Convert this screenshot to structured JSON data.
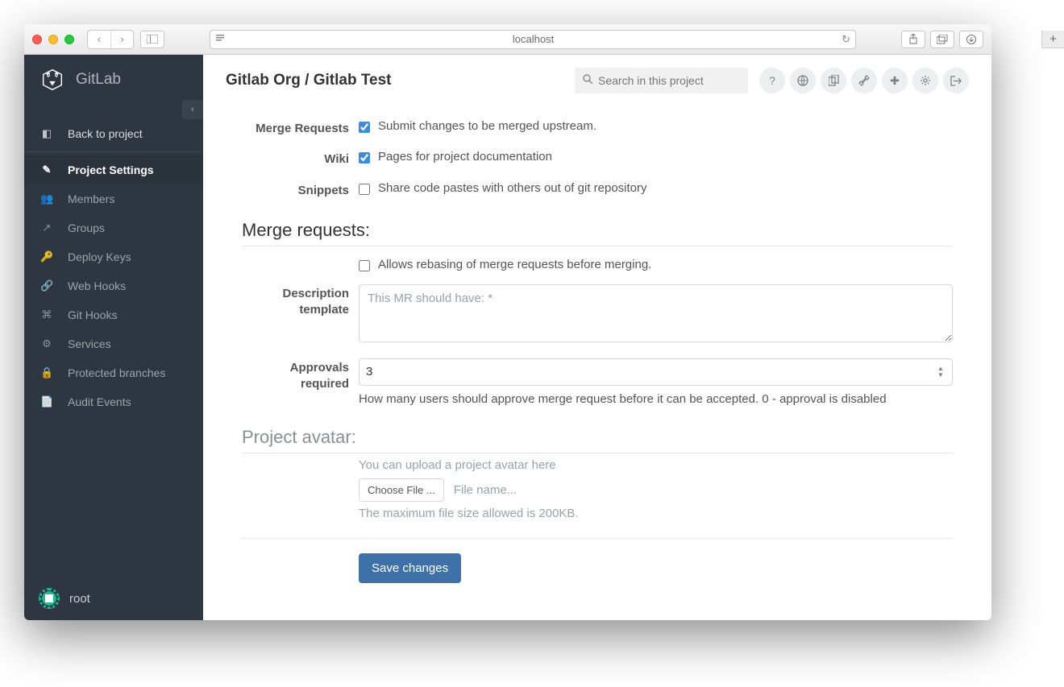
{
  "chrome": {
    "url": "localhost"
  },
  "brand": "GitLab",
  "sidebar": {
    "back": "Back to project",
    "items": [
      {
        "label": "Project Settings",
        "icon": "✎",
        "active": true
      },
      {
        "label": "Members",
        "icon": "👥"
      },
      {
        "label": "Groups",
        "icon": "↗"
      },
      {
        "label": "Deploy Keys",
        "icon": "🔑"
      },
      {
        "label": "Web Hooks",
        "icon": "🔗"
      },
      {
        "label": "Git Hooks",
        "icon": "⌘"
      },
      {
        "label": "Services",
        "icon": "⚙"
      },
      {
        "label": "Protected branches",
        "icon": "🔒"
      },
      {
        "label": "Audit Events",
        "icon": "📄"
      }
    ],
    "user": "root"
  },
  "breadcrumb": "Gitlab Org / Gitlab Test",
  "search": {
    "placeholder": "Search in this project"
  },
  "features": {
    "merge_requests": {
      "label": "Merge Requests",
      "desc": "Submit changes to be merged upstream.",
      "checked": true
    },
    "wiki": {
      "label": "Wiki",
      "desc": "Pages for project documentation",
      "checked": true
    },
    "snippets": {
      "label": "Snippets",
      "desc": "Share code pastes with others out of git repository",
      "checked": false
    }
  },
  "sections": {
    "merge_requests_title": "Merge requests:",
    "avatar_title": "Project avatar:"
  },
  "mr": {
    "rebase": {
      "desc": "Allows rebasing of merge requests before merging.",
      "checked": false
    },
    "template": {
      "label": "Description template",
      "placeholder": "This MR should have: *"
    },
    "approvals": {
      "label": "Approvals required",
      "value": "3",
      "help": "How many users should approve merge request before it can be accepted. 0 - approval is disabled"
    }
  },
  "avatar": {
    "hint": "You can upload a project avatar here",
    "choose": "Choose File ...",
    "filename": "File name...",
    "max": "The maximum file size allowed is 200KB."
  },
  "save": "Save changes"
}
